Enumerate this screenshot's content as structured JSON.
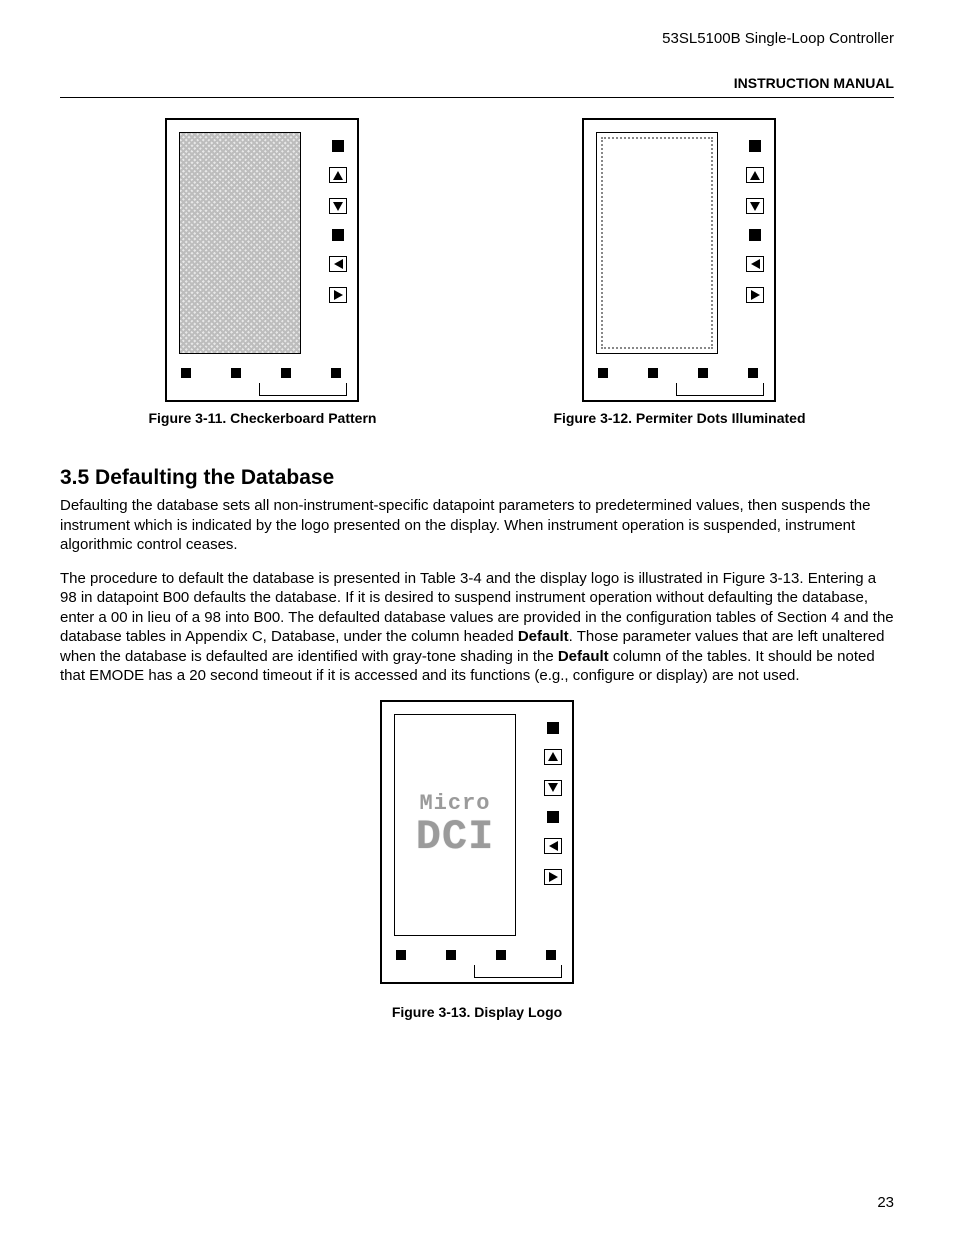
{
  "header": {
    "product": "53SL5100B Single-Loop Controller",
    "doc_type": "INSTRUCTION MANUAL"
  },
  "figures": {
    "f11": {
      "caption": "Figure 3-11. Checkerboard Pattern"
    },
    "f12": {
      "caption": "Figure 3-12. Permiter Dots Illuminated"
    },
    "f13": {
      "caption": "Figure 3-13. Display Logo",
      "logo_line1": "Micro",
      "logo_line2": "DCI"
    }
  },
  "section": {
    "number_title": "3.5  Defaulting the Database",
    "para1": "Defaulting the database sets all non-instrument-specific datapoint parameters to predetermined values, then suspends the instrument which is indicated by the logo presented on the display. When instrument operation is suspended, instrument algorithmic control ceases.",
    "para2_a": "The procedure to default the database is presented in Table 3-4 and the display logo is illustrated in Figure 3-13. Entering a 98 in datapoint B00 defaults the database. If it is desired to suspend instrument operation without defaulting the database, enter a 00 in lieu of a 98 into B00. The defaulted database values are provided in the configuration tables of Section 4 and the database tables in Appendix C, Database, under the column headed ",
    "para2_bold1": "Default",
    "para2_b": ". Those parameter values that are left unaltered when the database is defaulted are identified with gray-tone shading in the ",
    "para2_bold2": "Default",
    "para2_c": " column of the tables. It should be noted that EMODE has a 20 second timeout if it is accessed and its functions (e.g., configure or display) are not used."
  },
  "page_number": "23"
}
